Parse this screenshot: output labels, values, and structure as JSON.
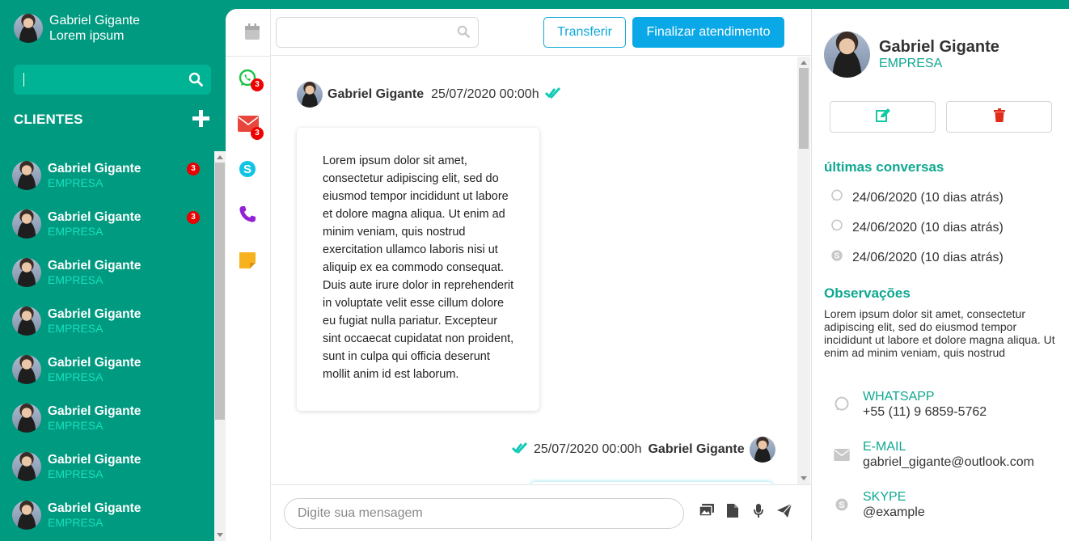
{
  "colors": {
    "brand": "#009a80",
    "accent_text": "#17e0bd",
    "teal_text": "#10a891",
    "primary_button": "#0aa8e6",
    "badge": "#ee0000"
  },
  "user": {
    "name": "Gabriel Gigante",
    "subtitle": "Lorem ipsum"
  },
  "sidebar": {
    "search_icon": "search-icon",
    "clients_heading": "CLIENTES",
    "add_icon": "plus-icon",
    "clients": [
      {
        "name": "Gabriel Gigante",
        "company": "EMPRESA",
        "badge": "3"
      },
      {
        "name": "Gabriel Gigante",
        "company": "EMPRESA",
        "badge": "3"
      },
      {
        "name": "Gabriel Gigante",
        "company": "EMPRESA"
      },
      {
        "name": "Gabriel Gigante",
        "company": "EMPRESA"
      },
      {
        "name": "Gabriel Gigante",
        "company": "EMPRESA"
      },
      {
        "name": "Gabriel Gigante",
        "company": "EMPRESA"
      },
      {
        "name": "Gabriel Gigante",
        "company": "EMPRESA"
      },
      {
        "name": "Gabriel Gigante",
        "company": "EMPRESA"
      }
    ]
  },
  "channels": [
    {
      "icon": "whatsapp-icon",
      "badge": "3"
    },
    {
      "icon": "email-icon",
      "badge": "3"
    },
    {
      "icon": "skype-icon"
    },
    {
      "icon": "phone-icon"
    },
    {
      "icon": "note-icon"
    }
  ],
  "toolbar": {
    "transfer_label": "Transferir",
    "finish_label": "Finalizar atendimento",
    "calendar_icon": "calendar-icon"
  },
  "chat": {
    "messages": [
      {
        "author": "Gabriel Gigante",
        "datetime": "25/07/2020 00:00h",
        "text": "Lorem ipsum dolor sit amet, consectetur adipiscing elit, sed do eiusmod tempor incididunt ut labore et dolore magna aliqua. Ut enim ad minim veniam, quis nostrud exercitation ullamco laboris nisi ut aliquip ex ea commodo consequat. Duis aute irure dolor in reprehenderit in voluptate velit esse cillum dolore eu fugiat nulla pariatur. Excepteur sint occaecat cupidatat non proident, sunt in culpa qui officia deserunt mollit anim id est laborum."
      },
      {
        "author": "Gabriel Gigante",
        "datetime": "25/07/2020 00:00h"
      }
    ]
  },
  "composer": {
    "placeholder": "Digite sua mensagem",
    "icons": [
      "image-icon",
      "file-icon",
      "microphone-icon",
      "send-icon"
    ]
  },
  "contact": {
    "name": "Gabriel Gigante",
    "company": "EMPRESA",
    "recent_heading": "últimas conversas",
    "recent": [
      {
        "icon": "whatsapp-icon",
        "text": "24/06/2020 (10 dias atrás)"
      },
      {
        "icon": "whatsapp-icon",
        "text": "24/06/2020 (10 dias atrás)"
      },
      {
        "icon": "skype-icon",
        "text": "24/06/2020 (10 dias atrás)"
      }
    ],
    "notes_heading": "Observações",
    "notes": "Lorem ipsum dolor sit amet, consectetur adipiscing elit, sed do eiusmod tempor incididunt ut labore et dolore magna aliqua. Ut enim ad minim veniam, quis nostrud",
    "channels": [
      {
        "icon": "whatsapp-icon",
        "label": "WHATSAPP",
        "value": "+55 (11) 9 6859-5762"
      },
      {
        "icon": "email-icon",
        "label": "E-MAIL",
        "value": "gabriel_gigante@outlook.com"
      },
      {
        "icon": "skype-icon",
        "label": "SKYPE",
        "value": "@example"
      }
    ]
  }
}
